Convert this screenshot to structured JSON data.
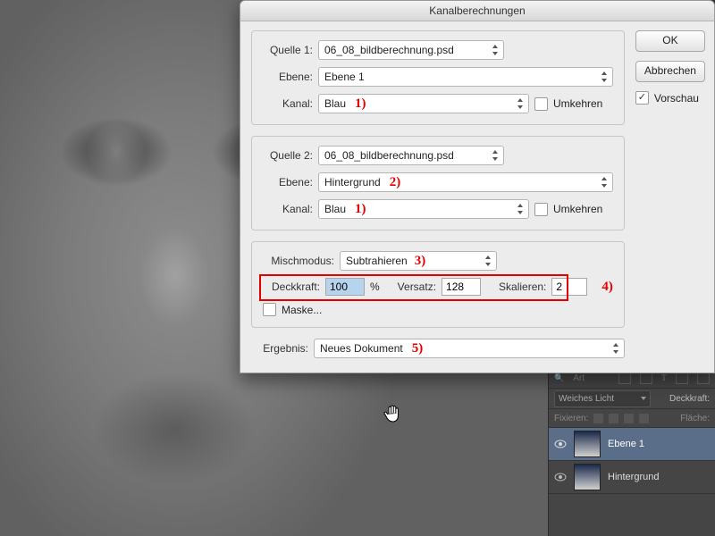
{
  "dialog": {
    "title": "Kanalberechnungen",
    "source1": {
      "group_label": "Quelle 1:",
      "file": "06_08_bildberechnung.psd",
      "ebene_label": "Ebene:",
      "ebene_value": "Ebene 1",
      "kanal_label": "Kanal:",
      "kanal_value": "Blau",
      "invert_label": "Umkehren",
      "invert_checked": false
    },
    "source2": {
      "group_label": "Quelle 2:",
      "file": "06_08_bildberechnung.psd",
      "ebene_label": "Ebene:",
      "ebene_value": "Hintergrund",
      "kanal_label": "Kanal:",
      "kanal_value": "Blau",
      "invert_label": "Umkehren",
      "invert_checked": false
    },
    "blend": {
      "mode_label": "Mischmodus:",
      "mode_value": "Subtrahieren",
      "opacity_label": "Deckkraft:",
      "opacity_value": "100",
      "opacity_unit": "%",
      "offset_label": "Versatz:",
      "offset_value": "128",
      "scale_label": "Skalieren:",
      "scale_value": "2",
      "mask_label": "Maske..."
    },
    "result": {
      "label": "Ergebnis:",
      "value": "Neues Dokument"
    },
    "buttons": {
      "ok": "OK",
      "cancel": "Abbrechen",
      "preview_label": "Vorschau",
      "preview_checked": true
    }
  },
  "annotations": {
    "a1": "1)",
    "a2": "2)",
    "a3": "3)",
    "a4": "4)",
    "a5": "5)"
  },
  "layers_panel": {
    "filter_label": "Art",
    "blend_mode": "Weiches Licht",
    "opacity_label": "Deckkraft:",
    "lock_label": "Fixieren:",
    "fill_label": "Fläche:",
    "layers": [
      {
        "name": "Ebene 1",
        "visible": true,
        "selected": true
      },
      {
        "name": "Hintergrund",
        "visible": true,
        "selected": false
      }
    ]
  }
}
